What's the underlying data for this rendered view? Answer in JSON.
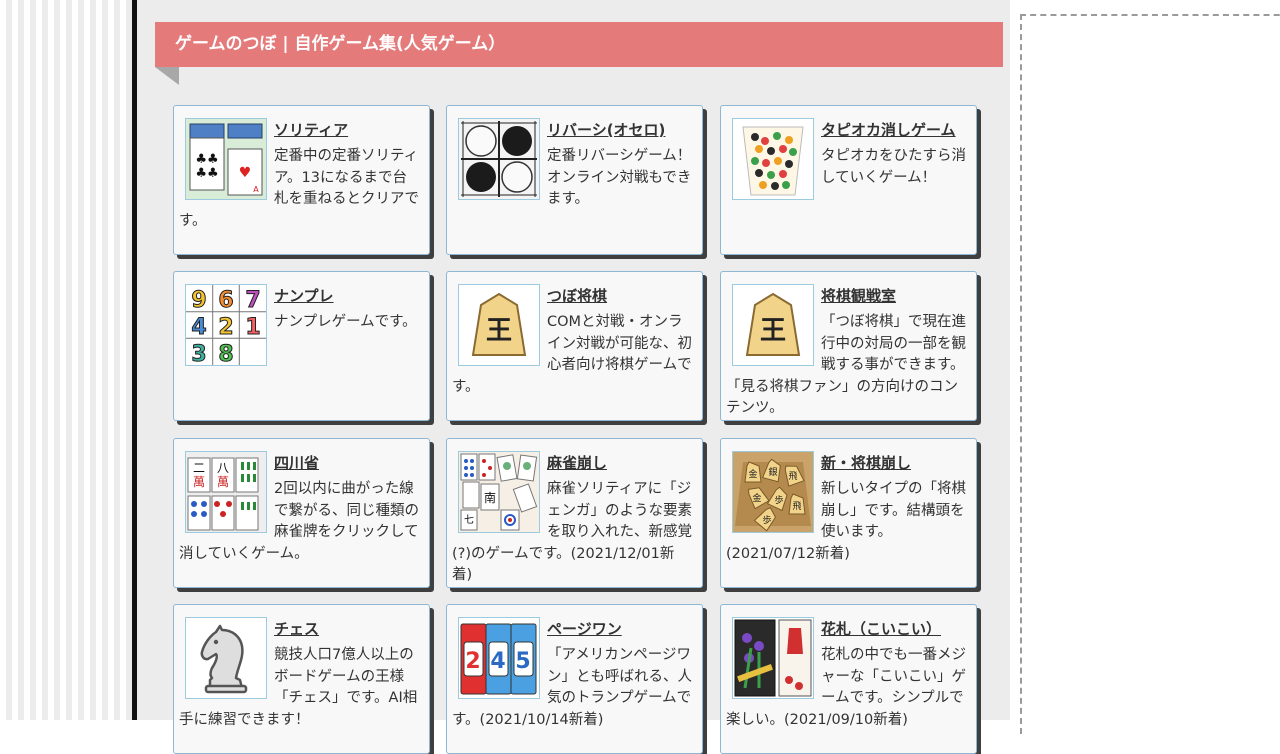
{
  "section": {
    "title": "ゲームのつぼ | 自作ゲーム集(人気ゲーム）"
  },
  "games": [
    {
      "title": "ソリティア",
      "desc": "定番中の定番ソリティア。13になるまで台札を重ねるとクリアです。",
      "icon": "solitaire-icon"
    },
    {
      "title": "リバーシ(オセロ)",
      "desc": "定番リバーシゲーム！オンライン対戦もできます。",
      "icon": "reversi-icon"
    },
    {
      "title": "タピオカ消しゲーム",
      "desc": "タピオカをひたすら消していくゲーム！",
      "icon": "tapioca-icon"
    },
    {
      "title": "ナンプレ",
      "desc": "ナンプレゲームです。",
      "icon": "numberplace-icon"
    },
    {
      "title": "つぼ将棋",
      "desc": "COMと対戦・オンライン対戦が可能な、初心者向け将棋ゲームです。",
      "icon": "shogi-king-icon"
    },
    {
      "title": "将棋観戦室",
      "desc": "「つぼ将棋」で現在進行中の対局の一部を観戦する事ができます。「見る将棋ファン」の方向けのコンテンツ。",
      "icon": "shogi-king-icon"
    },
    {
      "title": "四川省",
      "desc": "2回以内に曲がった線で繋がる、同じ種類の麻雀牌をクリックして消していくゲーム。",
      "icon": "shisensho-icon"
    },
    {
      "title": "麻雀崩し",
      "desc": "麻雀ソリティアに「ジェンガ」のような要素を取り入れた、新感覚(?)のゲームです。(2021/12/01新着)",
      "icon": "mahjong-collapse-icon"
    },
    {
      "title": "新・将棋崩し",
      "desc": "新しいタイプの「将棋崩し」です。結構頭を使います。(2021/07/12新着)",
      "icon": "shogi-collapse-icon"
    },
    {
      "title": "チェス",
      "desc": "競技人口7億人以上のボードゲームの王様「チェス」です。AI相手に練習できます！",
      "icon": "chess-knight-icon"
    },
    {
      "title": "ページワン",
      "desc": "「アメリカンページワン」とも呼ばれる、人気のトランプゲームです。(2021/10/14新着)",
      "icon": "pageone-cards-icon"
    },
    {
      "title": "花札（こいこい）",
      "desc": "花札の中でも一番メジャーな「こいこい」ゲームです。シンプルで楽しい。(2021/09/10新着)",
      "icon": "hanafuda-icon"
    }
  ],
  "numberplace_digits": [
    "9",
    "6",
    "7",
    "4",
    "2",
    "1",
    "3",
    "8",
    ""
  ],
  "tile_chars": {
    "ni": "二",
    "hachi": "八",
    "man": "萬",
    "nan": "南",
    "kin": "金",
    "gin": "銀",
    "hisha": "飛",
    "fu": "歩",
    "kaku": "角",
    "ou": "王",
    "shichi": "七"
  },
  "colors": {
    "header": "#e57a7a",
    "card_border": "#8fb7d4",
    "card_shadow": "#3f3f3f",
    "main_bg": "#ececec"
  }
}
